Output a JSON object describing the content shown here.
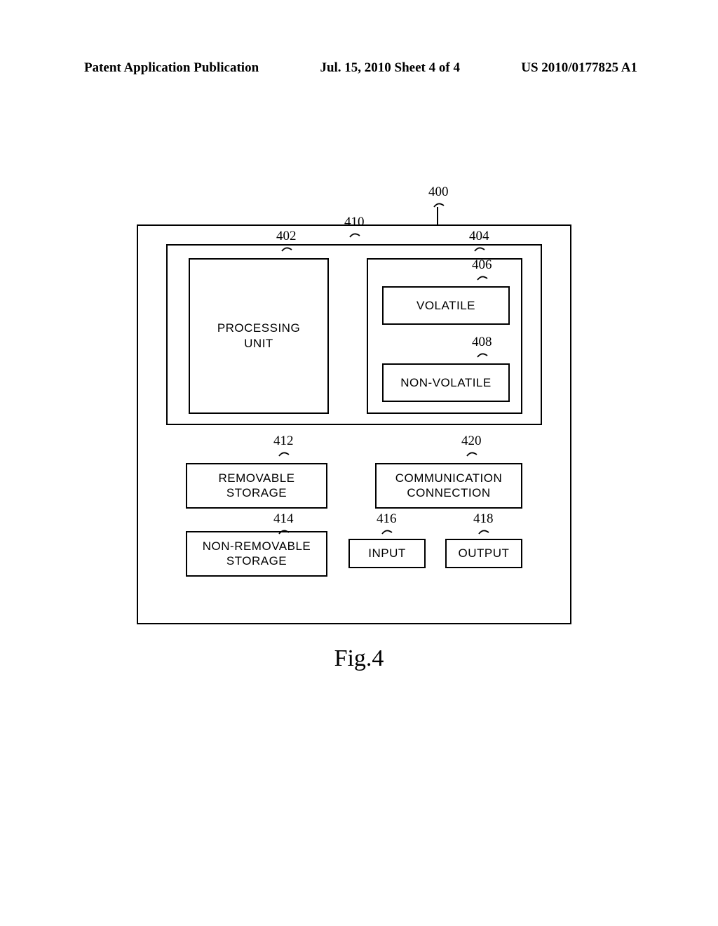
{
  "header": {
    "left": "Patent Application Publication",
    "center": "Jul. 15, 2010   Sheet 4 of 4",
    "right": "US 2010/0177825 A1"
  },
  "labels": {
    "ref400": "400",
    "ref410": "410",
    "ref402": "402",
    "ref404": "404",
    "ref406": "406",
    "ref408": "408",
    "ref412": "412",
    "ref414": "414",
    "ref416": "416",
    "ref418": "418",
    "ref420": "420"
  },
  "blocks": {
    "processing_unit": "PROCESSING\nUNIT",
    "volatile": "VOLATILE",
    "nonvolatile": "NON-VOLATILE",
    "removable_storage": "REMOVABLE\nSTORAGE",
    "nonremovable_storage": "NON-REMOVABLE\nSTORAGE",
    "comm_connection": "COMMUNICATION\nCONNECTION",
    "input": "INPUT",
    "output": "OUTPUT"
  },
  "caption": "Fig.4"
}
